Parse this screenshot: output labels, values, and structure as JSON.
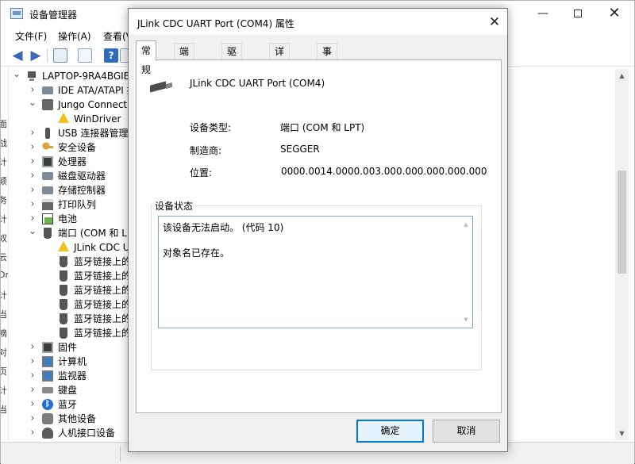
{
  "device_manager": {
    "title": "设备管理器",
    "menus": [
      "文件(F)",
      "操作(A)",
      "查看(V"
    ],
    "left_strip_chars": [
      "面",
      "战",
      "计",
      "颖",
      "务",
      "计",
      "奴",
      "云",
      "Dr",
      "计",
      "当",
      "嘀",
      "对",
      "页",
      "计",
      "当"
    ],
    "tree": [
      {
        "label": "LAPTOP-9RA4BGIB",
        "level": 0,
        "expand": "down",
        "icon": "pc"
      },
      {
        "label": "IDE ATA/ATAPI 控",
        "level": 1,
        "expand": "right",
        "icon": "drive"
      },
      {
        "label": "Jungo Connectiv",
        "level": 1,
        "expand": "down",
        "icon": "grey"
      },
      {
        "label": "WinDriver",
        "level": 2,
        "expand": "",
        "icon": "warn"
      },
      {
        "label": "USB 连接器管理器",
        "level": 1,
        "expand": "right",
        "icon": "usb"
      },
      {
        "label": "安全设备",
        "level": 1,
        "expand": "right",
        "icon": "key"
      },
      {
        "label": "处理器",
        "level": 1,
        "expand": "right",
        "icon": "chip"
      },
      {
        "label": "磁盘驱动器",
        "level": 1,
        "expand": "right",
        "icon": "drive"
      },
      {
        "label": "存储控制器",
        "level": 1,
        "expand": "right",
        "icon": "drive"
      },
      {
        "label": "打印队列",
        "level": 1,
        "expand": "right",
        "icon": "printer"
      },
      {
        "label": "电池",
        "level": 1,
        "expand": "right",
        "icon": "battery"
      },
      {
        "label": "端口 (COM 和 LP",
        "level": 1,
        "expand": "down",
        "icon": "port"
      },
      {
        "label": "JLink CDC UA",
        "level": 2,
        "expand": "",
        "icon": "warn"
      },
      {
        "label": "蓝牙链接上的",
        "level": 2,
        "expand": "",
        "icon": "port"
      },
      {
        "label": "蓝牙链接上的",
        "level": 2,
        "expand": "",
        "icon": "port"
      },
      {
        "label": "蓝牙链接上的",
        "level": 2,
        "expand": "",
        "icon": "port"
      },
      {
        "label": "蓝牙链接上的",
        "level": 2,
        "expand": "",
        "icon": "port"
      },
      {
        "label": "蓝牙链接上的",
        "level": 2,
        "expand": "",
        "icon": "port"
      },
      {
        "label": "蓝牙链接上的",
        "level": 2,
        "expand": "",
        "icon": "port"
      },
      {
        "label": "固件",
        "level": 1,
        "expand": "right",
        "icon": "chip"
      },
      {
        "label": "计算机",
        "level": 1,
        "expand": "right",
        "icon": "monitor"
      },
      {
        "label": "监视器",
        "level": 1,
        "expand": "right",
        "icon": "monitor"
      },
      {
        "label": "键盘",
        "level": 1,
        "expand": "right",
        "icon": "kbd"
      },
      {
        "label": "蓝牙",
        "level": 1,
        "expand": "right",
        "icon": "bt"
      },
      {
        "label": "其他设备",
        "level": 1,
        "expand": "right",
        "icon": "other"
      },
      {
        "label": "人机接口设备",
        "level": 1,
        "expand": "right",
        "icon": "hid"
      }
    ]
  },
  "dialog": {
    "title": "JLink CDC UART Port (COM4) 属性",
    "close_glyph": "✕",
    "tabs": [
      "常规",
      "端口设置",
      "驱动程序",
      "详细信息",
      "事件"
    ],
    "active_tab": 0,
    "device_name": "JLink CDC UART Port (COM4)",
    "props": [
      {
        "label": "设备类型:",
        "value": "端口 (COM 和 LPT)"
      },
      {
        "label": "制造商:",
        "value": "SEGGER"
      },
      {
        "label": "位置:",
        "value": "0000.0014.0000.003.000.000.000.000.000"
      }
    ],
    "status_title": "设备状态",
    "status_lines": [
      "该设备无法启动。 (代码 10)",
      "对象名已存在。"
    ],
    "ok_label": "确定",
    "cancel_label": "取消"
  },
  "colors": {
    "focus_blue": "#0078d7",
    "warning_yellow": "#f2c21b",
    "textbox_border": "#7aa7d6"
  }
}
